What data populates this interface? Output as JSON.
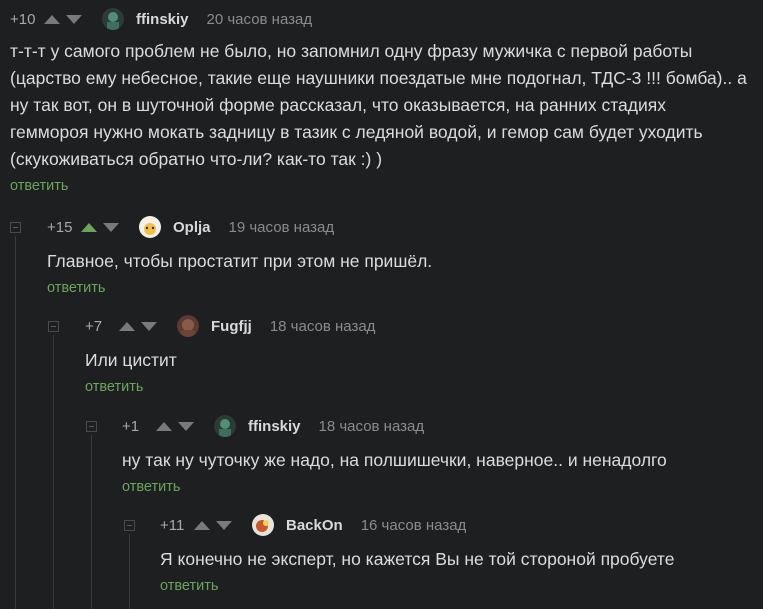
{
  "reply_label": "ответить",
  "comments": [
    {
      "score": "+10",
      "author": "ffinskiy",
      "time": "20 часов назад",
      "text": "т-т-т у самого проблем не было, но запомнил одну фразу мужичка с первой работы\n(царство ему небесное, такие еще наушники поездатые мне подогнал, ТДС-3 !!! бомба).. а\nну так вот, он в шуточной форме рассказал, что оказывается, на ранних стадиях\nгеммороя нужно мокать задницу в тазик с ледяной водой, и гемор сам будет уходить\n(скукоживаться обратно что-ли? как-то так :) )"
    },
    {
      "score": "+15",
      "author": "Oplja",
      "time": "19 часов назад",
      "text": "Главное, чтобы простатит при этом не пришёл."
    },
    {
      "score": "+7",
      "author": "Fugfjj",
      "time": "18 часов назад",
      "text": "Или цистит"
    },
    {
      "score": "+1",
      "author": "ffinskiy",
      "time": "18 часов назад",
      "text": "ну так ну чуточку же надо, на полшишечки, наверное.. и ненадолго"
    },
    {
      "score": "+11",
      "author": "BackOn",
      "time": "16 часов назад",
      "text": "Я конечно не эксперт, но кажется Вы не той стороной пробуете"
    }
  ]
}
